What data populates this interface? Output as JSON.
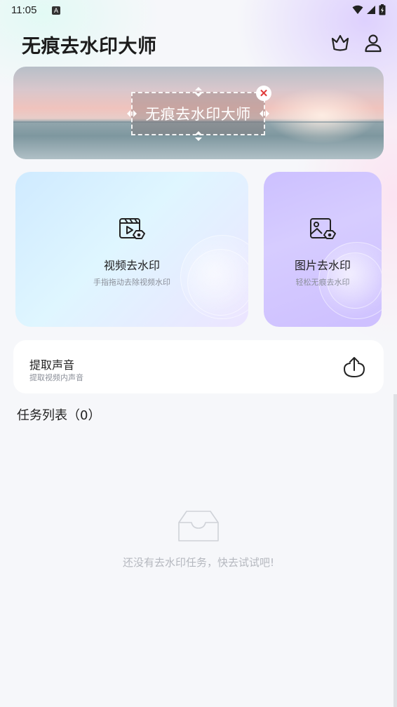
{
  "status_bar": {
    "time": "11:05",
    "notification_badge": "A",
    "icons": [
      "wifi-icon",
      "signal-icon",
      "battery-icon"
    ]
  },
  "header": {
    "title": "无痕去水印大师",
    "icons": [
      "crown-icon",
      "user-icon"
    ]
  },
  "banner": {
    "watermark_text": "无痕去水印大师",
    "close_symbol": "✕"
  },
  "features": {
    "video": {
      "title": "视频去水印",
      "subtitle": "手指拖动去除视频水印",
      "icon": "video-clapper-icon"
    },
    "image": {
      "title": "图片去水印",
      "subtitle": "轻松无痕去水印",
      "icon": "image-eraser-icon"
    }
  },
  "audio": {
    "title": "提取声音",
    "subtitle": "提取视频内声音",
    "icon": "upload-icon"
  },
  "tasks": {
    "title": "任务列表（0）",
    "empty_message": "还没有去水印任务，快去试试吧!",
    "empty_icon": "empty-inbox-icon"
  },
  "colors": {
    "accent_purple": "#c9bcff",
    "accent_blue": "#d6efff",
    "close_red": "#e03a3a"
  }
}
